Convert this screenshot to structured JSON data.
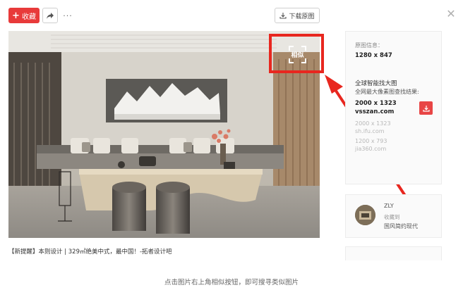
{
  "toolbar": {
    "collect_label": "收藏",
    "more_label": "···",
    "download_label": "下载原图",
    "close_glyph": "✕"
  },
  "image": {
    "caption": "【新提醒】本则设计 | 329㎡绝美中式，最中国！-拓者设计吧",
    "similar_label": "相似"
  },
  "info": {
    "original_label": "原图信息：",
    "original_size": "1280 x 847",
    "smart_title": "全球智能找大图",
    "smart_subtitle": "全网最大像素图查找结果:",
    "result1_size": "2000 x 1323",
    "result1_site": "vsszan.com",
    "result2_size": "2000 x 1323",
    "result2_site": "sh.ifu.com",
    "result3_size": "1200 x 793",
    "result3_site": "jia360.com"
  },
  "user": {
    "name": "ZLY",
    "action": "收藏到",
    "album": "国风简约现代"
  },
  "footer": {
    "hint": "点击图片右上角相似按钮，即可搜寻类似图片"
  },
  "colors": {
    "accent_red": "#e83a3a",
    "highlight_red": "#e8271f"
  }
}
